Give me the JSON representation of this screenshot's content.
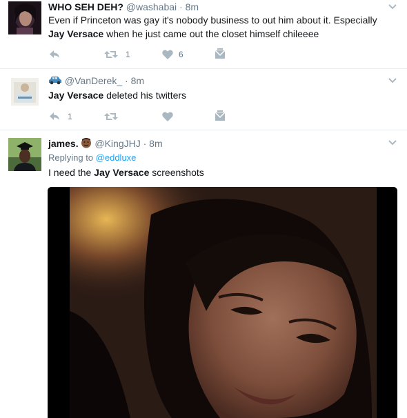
{
  "tweets": [
    {
      "name": "WHO SEH DEH?",
      "handle": "@washabai",
      "time": "8m",
      "text_pre": "Even if Princeton was gay it's nobody business to out him about it. Especially",
      "text_bold": "Jay Versace",
      "text_post": " when he just came out the closet himself chileeee",
      "retweets": "1",
      "likes": "6"
    },
    {
      "handle": "@VanDerek_",
      "time": "8m",
      "text_bold": "Jay Versace",
      "text_post": " deleted his twitters",
      "replies": "1"
    },
    {
      "name": "james.",
      "handle": "@KingJHJ",
      "time": "8m",
      "replying_prefix": "Replying to",
      "replying_handle": "@eddluxe",
      "text_pre": "I need the ",
      "text_bold": "Jay Versace",
      "text_post": " screenshots"
    }
  ],
  "separator": "·",
  "icons": {
    "reply": "reply-icon",
    "retweet": "retweet-icon",
    "like": "heart-icon",
    "dm": "direct-message-icon",
    "more": "chevron-down-icon",
    "vehicle": "car-emoji-icon",
    "face": "face-emoji-icon"
  },
  "colors": {
    "text": "#14171a",
    "muted": "#657786",
    "icon": "#aab8c2",
    "link": "#1da1f2",
    "divider": "#e6ecf0",
    "car": "#3b88c3"
  }
}
